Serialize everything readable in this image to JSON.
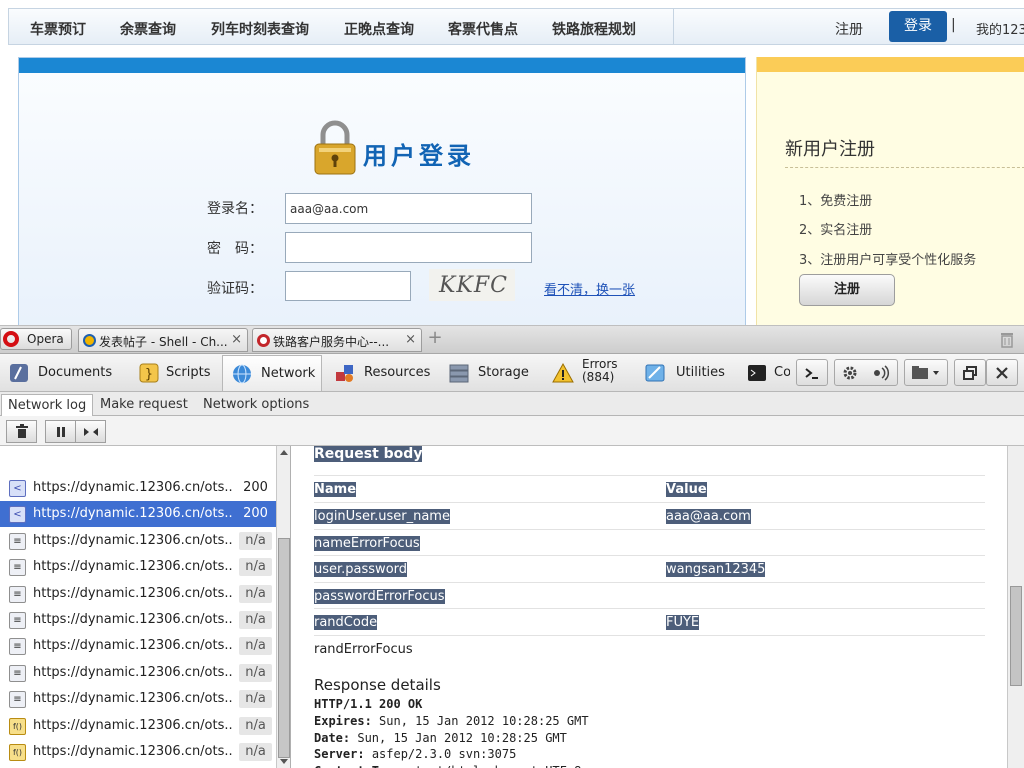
{
  "webpage": {
    "nav": [
      "车票预订",
      "余票查询",
      "列车时刻表查询",
      "正晚点查询",
      "客票代售点",
      "铁路旅程规划"
    ],
    "register_link": "注册",
    "login_button": "登录",
    "separator": "|",
    "my_account": "我的123",
    "login_panel": {
      "title": "用户登录",
      "username_label": "登录名：",
      "username_value": "aaa@aa.com",
      "password_label": "密　码：",
      "captcha_label": "验证码：",
      "captcha_text": "KKFC",
      "refresh_link": "看不清，换一张",
      "accent_color": "#1b87d3"
    },
    "register_panel": {
      "title": "新用户注册",
      "items": [
        "1、免费注册",
        "2、实名注册",
        "3、注册用户可享受个性化服务"
      ],
      "button": "注册",
      "accent_color": "#fbcc57"
    }
  },
  "browser": {
    "menu_label": "Opera",
    "tabs": [
      {
        "title": "发表帖子 - Shell - Ch...",
        "icon": "site-favicon",
        "close": "×"
      },
      {
        "title": "铁路客户服务中心--...",
        "icon": "railway-favicon",
        "close": "×"
      }
    ],
    "new_tab": "+"
  },
  "devtools": {
    "tabs": [
      {
        "label": "Documents",
        "icon": "documents-icon"
      },
      {
        "label": "Scripts",
        "icon": "scripts-icon"
      },
      {
        "label": "Network",
        "icon": "network-globe-icon",
        "active": true
      },
      {
        "label": "Resources",
        "icon": "resources-icon"
      },
      {
        "label": "Storage",
        "icon": "storage-icon"
      },
      {
        "label": "Errors",
        "count": "(884)",
        "icon": "warning-icon"
      },
      {
        "label": "Utilities",
        "icon": "utilities-icon"
      },
      {
        "label": "Co",
        "icon": "console-icon"
      }
    ],
    "subtabs": [
      "Network log",
      "Make request",
      "Network options"
    ],
    "requests": [
      {
        "url": "https://dynamic.12306.cn/ots...",
        "status": "200",
        "icon": "xhr-icon",
        "selected": false
      },
      {
        "url": "https://dynamic.12306.cn/ots...",
        "status": "200",
        "icon": "xhr-icon",
        "selected": true
      },
      {
        "url": "https://dynamic.12306.cn/ots...",
        "status": "n/a",
        "icon": "document-icon"
      },
      {
        "url": "https://dynamic.12306.cn/ots...",
        "status": "n/a",
        "icon": "document-icon"
      },
      {
        "url": "https://dynamic.12306.cn/ots...",
        "status": "n/a",
        "icon": "document-icon"
      },
      {
        "url": "https://dynamic.12306.cn/ots...",
        "status": "n/a",
        "icon": "document-icon"
      },
      {
        "url": "https://dynamic.12306.cn/ots...",
        "status": "n/a",
        "icon": "document-icon"
      },
      {
        "url": "https://dynamic.12306.cn/ots...",
        "status": "n/a",
        "icon": "document-icon"
      },
      {
        "url": "https://dynamic.12306.cn/ots...",
        "status": "n/a",
        "icon": "document-icon"
      },
      {
        "url": "https://dynamic.12306.cn/ots...",
        "status": "n/a",
        "icon": "script-icon"
      },
      {
        "url": "https://dynamic.12306.cn/ots...",
        "status": "n/a",
        "icon": "script-icon"
      }
    ],
    "request_body": {
      "heading": "Request body",
      "col_name": "Name",
      "col_value": "Value",
      "rows": [
        {
          "name": "loginUser.user_name",
          "value": "aaa@aa.com"
        },
        {
          "name": "nameErrorFocus",
          "value": ""
        },
        {
          "name": "user.password",
          "value": "wangsan12345"
        },
        {
          "name": "passwordErrorFocus",
          "value": ""
        },
        {
          "name": "randCode",
          "value": "FUYE"
        },
        {
          "name": "randErrorFocus",
          "value": ""
        }
      ]
    },
    "response": {
      "heading": "Response details",
      "status_line": "HTTP/1.1 200 OK",
      "headers": [
        {
          "key": "Expires:",
          "value": "Sun, 15 Jan 2012 10:28:25 GMT"
        },
        {
          "key": "Date:",
          "value": "Sun, 15 Jan 2012 10:28:25 GMT"
        },
        {
          "key": "Server:",
          "value": "asfep/2.3.0 svn:3075"
        },
        {
          "key": "Content-Type:",
          "value": "text/html;charset=UTF-8"
        }
      ]
    }
  }
}
